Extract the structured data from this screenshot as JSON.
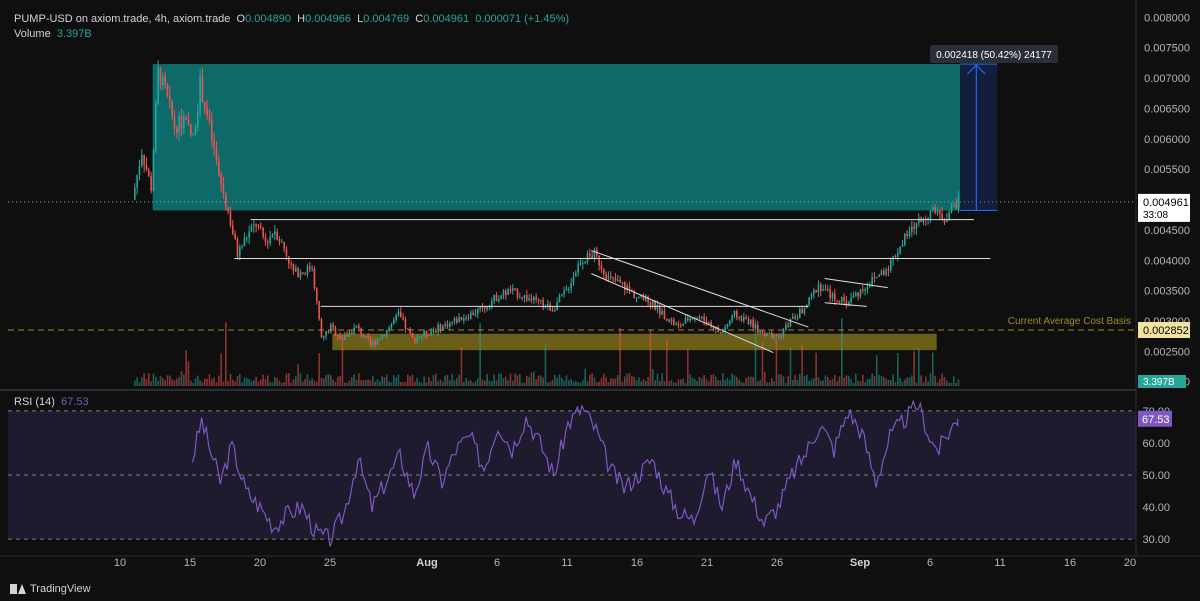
{
  "header": {
    "symbol": "PUMP-USD on axiom.trade, 4h, axiom.trade",
    "o_label": "O",
    "o": "0.004890",
    "h_label": "H",
    "h": "0.004966",
    "l_label": "L",
    "l": "0.004769",
    "c_label": "C",
    "c": "0.004961",
    "change": "0.000071 (+1.45%)",
    "volume_label": "Volume",
    "volume_value": "3.397B"
  },
  "rsi_header": {
    "label": "RSI (14)",
    "value": "67.53"
  },
  "branding": "TradingView",
  "colors": {
    "up": "#26a69a",
    "down": "#ef5350",
    "rsi": "#7e57c2",
    "zone": "#0e8c8c",
    "support": "#8a7a1c",
    "measure": "#2962ff"
  },
  "chart_data": [
    {
      "type": "candlestick",
      "title": "PUMP-USD on axiom.trade, 4h",
      "y_axis_ticks": [
        "0.008000",
        "0.007500",
        "0.007000",
        "0.006500",
        "0.006000",
        "0.005500",
        "0.005000",
        "0.004500",
        "0.004000",
        "0.003500",
        "0.003000",
        "0.002500",
        "0.002000"
      ],
      "ylim": [
        0.00193,
        0.00812
      ],
      "x_axis_ticks": [
        "10",
        "15",
        "20",
        "25",
        "Aug",
        "6",
        "11",
        "16",
        "21",
        "26",
        "Sep",
        "6",
        "11",
        "16",
        "20"
      ],
      "current_price_label": "0.004961",
      "countdown_label": "33:08",
      "cost_basis_label": "Current Average Cost Basis",
      "cost_basis_value": "0.002852",
      "volume_badge": "3.397B",
      "measure_label": "0.002418 (50.42%) 24177",
      "price_anchors": [
        [
          "2025-07-11 00:00",
          0.005
        ],
        [
          "2025-07-11 16:00",
          0.0058
        ],
        [
          "2025-07-12 08:00",
          0.0052
        ],
        [
          "2025-07-12 20:00",
          0.0071
        ],
        [
          "2025-07-13 08:00",
          0.0068
        ],
        [
          "2025-07-14 00:00",
          0.0062
        ],
        [
          "2025-07-14 16:00",
          0.0063
        ],
        [
          "2025-07-15 08:00",
          0.006
        ],
        [
          "2025-07-15 20:00",
          0.0069
        ],
        [
          "2025-07-16 12:00",
          0.0062
        ],
        [
          "2025-07-17 04:00",
          0.0054
        ],
        [
          "2025-07-17 20:00",
          0.0048
        ],
        [
          "2025-07-18 12:00",
          0.0041
        ],
        [
          "2025-07-19 04:00",
          0.0044
        ],
        [
          "2025-07-19 20:00",
          0.0046
        ],
        [
          "2025-07-20 12:00",
          0.0043
        ],
        [
          "2025-07-21 04:00",
          0.0045
        ],
        [
          "2025-07-21 20:00",
          0.0042
        ],
        [
          "2025-07-22 12:00",
          0.0038
        ],
        [
          "2025-07-23 04:00",
          0.0038
        ],
        [
          "2025-07-23 20:00",
          0.0039
        ],
        [
          "2025-07-24 12:00",
          0.0027
        ],
        [
          "2025-07-25 04:00",
          0.0029
        ],
        [
          "2025-07-26 00:00",
          0.0027
        ],
        [
          "2025-07-27 00:00",
          0.0029
        ],
        [
          "2025-07-28 00:00",
          0.0026
        ],
        [
          "2025-07-29 00:00",
          0.0028
        ],
        [
          "2025-07-30 00:00",
          0.0031
        ],
        [
          "2025-07-31 00:00",
          0.0027
        ],
        [
          "2025-08-01 00:00",
          0.0028
        ],
        [
          "2025-08-02 00:00",
          0.0029
        ],
        [
          "2025-08-03 00:00",
          0.003
        ],
        [
          "2025-08-04 00:00",
          0.0031
        ],
        [
          "2025-08-05 00:00",
          0.0032
        ],
        [
          "2025-08-06 00:00",
          0.0034
        ],
        [
          "2025-08-07 00:00",
          0.0035
        ],
        [
          "2025-08-08 00:00",
          0.0034
        ],
        [
          "2025-08-09 00:00",
          0.0033
        ],
        [
          "2025-08-10 00:00",
          0.0032
        ],
        [
          "2025-08-11 00:00",
          0.0035
        ],
        [
          "2025-08-12 00:00",
          0.004
        ],
        [
          "2025-08-13 00:00",
          0.0041
        ],
        [
          "2025-08-14 00:00",
          0.0037
        ],
        [
          "2025-08-15 00:00",
          0.0036
        ],
        [
          "2025-08-16 00:00",
          0.0034
        ],
        [
          "2025-08-17 00:00",
          0.0033
        ],
        [
          "2025-08-18 00:00",
          0.0031
        ],
        [
          "2025-08-19 00:00",
          0.0029
        ],
        [
          "2025-08-20 00:00",
          0.0031
        ],
        [
          "2025-08-21 00:00",
          0.003
        ],
        [
          "2025-08-22 00:00",
          0.0028
        ],
        [
          "2025-08-23 00:00",
          0.0031
        ],
        [
          "2025-08-24 00:00",
          0.003
        ],
        [
          "2025-08-25 00:00",
          0.0028
        ],
        [
          "2025-08-26 00:00",
          0.0027
        ],
        [
          "2025-08-27 00:00",
          0.003
        ],
        [
          "2025-08-28 00:00",
          0.0032
        ],
        [
          "2025-08-29 00:00",
          0.0036
        ],
        [
          "2025-08-30 00:00",
          0.0034
        ],
        [
          "2025-08-31 00:00",
          0.0033
        ],
        [
          "2025-09-01 00:00",
          0.0035
        ],
        [
          "2025-09-02 00:00",
          0.0037
        ],
        [
          "2025-09-03 00:00",
          0.0039
        ],
        [
          "2025-09-04 00:00",
          0.0043
        ],
        [
          "2025-09-05 00:00",
          0.0046
        ],
        [
          "2025-09-06 00:00",
          0.0048
        ],
        [
          "2025-09-07 00:00",
          0.0047
        ],
        [
          "2025-09-07 20:00",
          0.00496
        ]
      ],
      "zones": [
        {
          "name": "target-zone",
          "from_date": "2025-07-12 08:00",
          "to_date": "2025-09-08 00:00",
          "high": 0.00723,
          "low": 0.00482
        },
        {
          "name": "support-zone",
          "from_date": "2025-07-25 04:00",
          "to_date": "2025-09-06 08:00",
          "high": 0.00279,
          "low": 0.00252
        }
      ],
      "h_lines": [
        {
          "from_date": "2025-07-19 08:00",
          "to_date": "2025-09-09 00:00",
          "price": 0.00467
        },
        {
          "from_date": "2025-07-18 04:00",
          "to_date": "2025-09-10 04:00",
          "price": 0.00403
        },
        {
          "from_date": "2025-07-24 08:00",
          "to_date": "2025-08-28 04:00",
          "price": 0.00324
        }
      ],
      "diag_lines": [
        {
          "d1": "2025-08-12 16:00",
          "p1": 0.00416,
          "d2": "2025-08-28 04:00",
          "p2": 0.0029
        },
        {
          "d1": "2025-08-12 16:00",
          "p1": 0.00378,
          "d2": "2025-08-25 16:00",
          "p2": 0.00248
        },
        {
          "d1": "2025-08-29 08:00",
          "p1": 0.0037,
          "d2": "2025-09-02 20:00",
          "p2": 0.00355
        },
        {
          "d1": "2025-08-29 08:00",
          "p1": 0.0033,
          "d2": "2025-09-01 08:00",
          "p2": 0.00324
        }
      ],
      "measure": {
        "date": "2025-09-09 04:00",
        "from_price": 0.00482,
        "to_price": 0.00723,
        "start_date": "2025-09-08 00:00",
        "end_date": "2025-09-10 16:00"
      }
    },
    {
      "type": "line",
      "title": "RSI (14)",
      "y_axis_ticks": [
        "70.00",
        "60.00",
        "50.00",
        "40.00",
        "30.00"
      ],
      "ylim": [
        26,
        74
      ],
      "levels": {
        "upper": 70,
        "middle": 50,
        "lower": 30
      },
      "current_value_label": "67.53",
      "anchors": [
        [
          "2025-07-15 04:00",
          55
        ],
        [
          "2025-07-15 20:00",
          67
        ],
        [
          "2025-07-16 12:00",
          57
        ],
        [
          "2025-07-17 04:00",
          48
        ],
        [
          "2025-07-18 00:00",
          59
        ],
        [
          "2025-07-19 00:00",
          45
        ],
        [
          "2025-07-20 00:00",
          40
        ],
        [
          "2025-07-21 00:00",
          34
        ],
        [
          "2025-07-22 00:00",
          38
        ],
        [
          "2025-07-23 00:00",
          40
        ],
        [
          "2025-07-24 00:00",
          32
        ],
        [
          "2025-07-25 00:00",
          30
        ],
        [
          "2025-07-26 00:00",
          38
        ],
        [
          "2025-07-27 00:00",
          55
        ],
        [
          "2025-07-28 00:00",
          40
        ],
        [
          "2025-07-29 00:00",
          48
        ],
        [
          "2025-07-30 00:00",
          56
        ],
        [
          "2025-07-31 00:00",
          44
        ],
        [
          "2025-08-01 00:00",
          58
        ],
        [
          "2025-08-02 00:00",
          48
        ],
        [
          "2025-08-03 00:00",
          58
        ],
        [
          "2025-08-04 00:00",
          62
        ],
        [
          "2025-08-05 00:00",
          52
        ],
        [
          "2025-08-06 00:00",
          66
        ],
        [
          "2025-08-07 00:00",
          58
        ],
        [
          "2025-08-08 00:00",
          68
        ],
        [
          "2025-08-09 00:00",
          60
        ],
        [
          "2025-08-10 00:00",
          50
        ],
        [
          "2025-08-11 00:00",
          66
        ],
        [
          "2025-08-12 00:00",
          71
        ],
        [
          "2025-08-13 00:00",
          64
        ],
        [
          "2025-08-14 00:00",
          52
        ],
        [
          "2025-08-15 00:00",
          46
        ],
        [
          "2025-08-16 00:00",
          50
        ],
        [
          "2025-08-17 00:00",
          55
        ],
        [
          "2025-08-18 00:00",
          45
        ],
        [
          "2025-08-19 00:00",
          38
        ],
        [
          "2025-08-20 00:00",
          36
        ],
        [
          "2025-08-21 00:00",
          52
        ],
        [
          "2025-08-22 00:00",
          40
        ],
        [
          "2025-08-23 00:00",
          55
        ],
        [
          "2025-08-24 00:00",
          44
        ],
        [
          "2025-08-25 00:00",
          35
        ],
        [
          "2025-08-26 00:00",
          40
        ],
        [
          "2025-08-27 00:00",
          50
        ],
        [
          "2025-08-28 00:00",
          57
        ],
        [
          "2025-08-29 00:00",
          66
        ],
        [
          "2025-08-30 00:00",
          58
        ],
        [
          "2025-08-31 00:00",
          70
        ],
        [
          "2025-09-01 00:00",
          63
        ],
        [
          "2025-09-02 00:00",
          48
        ],
        [
          "2025-09-03 00:00",
          62
        ],
        [
          "2025-09-04 00:00",
          67
        ],
        [
          "2025-09-05 00:00",
          72
        ],
        [
          "2025-09-06 00:00",
          60
        ],
        [
          "2025-09-06 12:00",
          58
        ],
        [
          "2025-09-07 00:00",
          62
        ],
        [
          "2025-09-07 20:00",
          67.53
        ]
      ]
    }
  ]
}
